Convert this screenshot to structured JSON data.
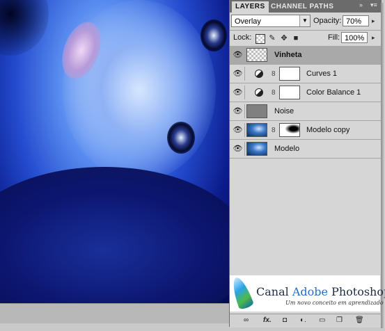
{
  "layers_panel": {
    "tabs": [
      {
        "label": "LAYERS",
        "active": true
      },
      {
        "label": "CHANNEL PATHS",
        "active": false
      }
    ],
    "blend_mode": "Overlay",
    "opacity_label": "Opacity:",
    "opacity_value": "70%",
    "lock_label": "Lock:",
    "fill_label": "Fill:",
    "fill_value": "100%",
    "layers": [
      {
        "name": "Vinheta",
        "selected": true,
        "thumb": "transparent",
        "adjustment": false,
        "mask": false
      },
      {
        "name": "Curves 1",
        "selected": false,
        "thumb": "curves",
        "adjustment": true,
        "mask": true
      },
      {
        "name": "Color Balance 1",
        "selected": false,
        "thumb": "color-balance",
        "adjustment": true,
        "mask": true
      },
      {
        "name": "Noise",
        "selected": false,
        "thumb": "gray",
        "adjustment": false,
        "mask": false
      },
      {
        "name": "Modelo copy",
        "selected": false,
        "thumb": "photo",
        "adjustment": false,
        "mask": true
      },
      {
        "name": "Modelo",
        "selected": false,
        "thumb": "photo",
        "adjustment": false,
        "mask": false
      }
    ],
    "footer_icons": [
      "link-icon",
      "fx-icon",
      "mask-icon",
      "adjustment-icon",
      "group-icon",
      "new-layer-icon",
      "trash-icon"
    ]
  },
  "watermark": {
    "main_part1": "Canal ",
    "main_part2": "Adobe",
    "main_part3": " Photoshop",
    "subtitle": "Um novo conceito em aprendizado"
  },
  "colors": {
    "photo_tint": "#244ccf",
    "panel_bg": "#d6d6d6",
    "selected_layer": "#a9a9a9",
    "brand_blue": "#1e6fc8"
  }
}
